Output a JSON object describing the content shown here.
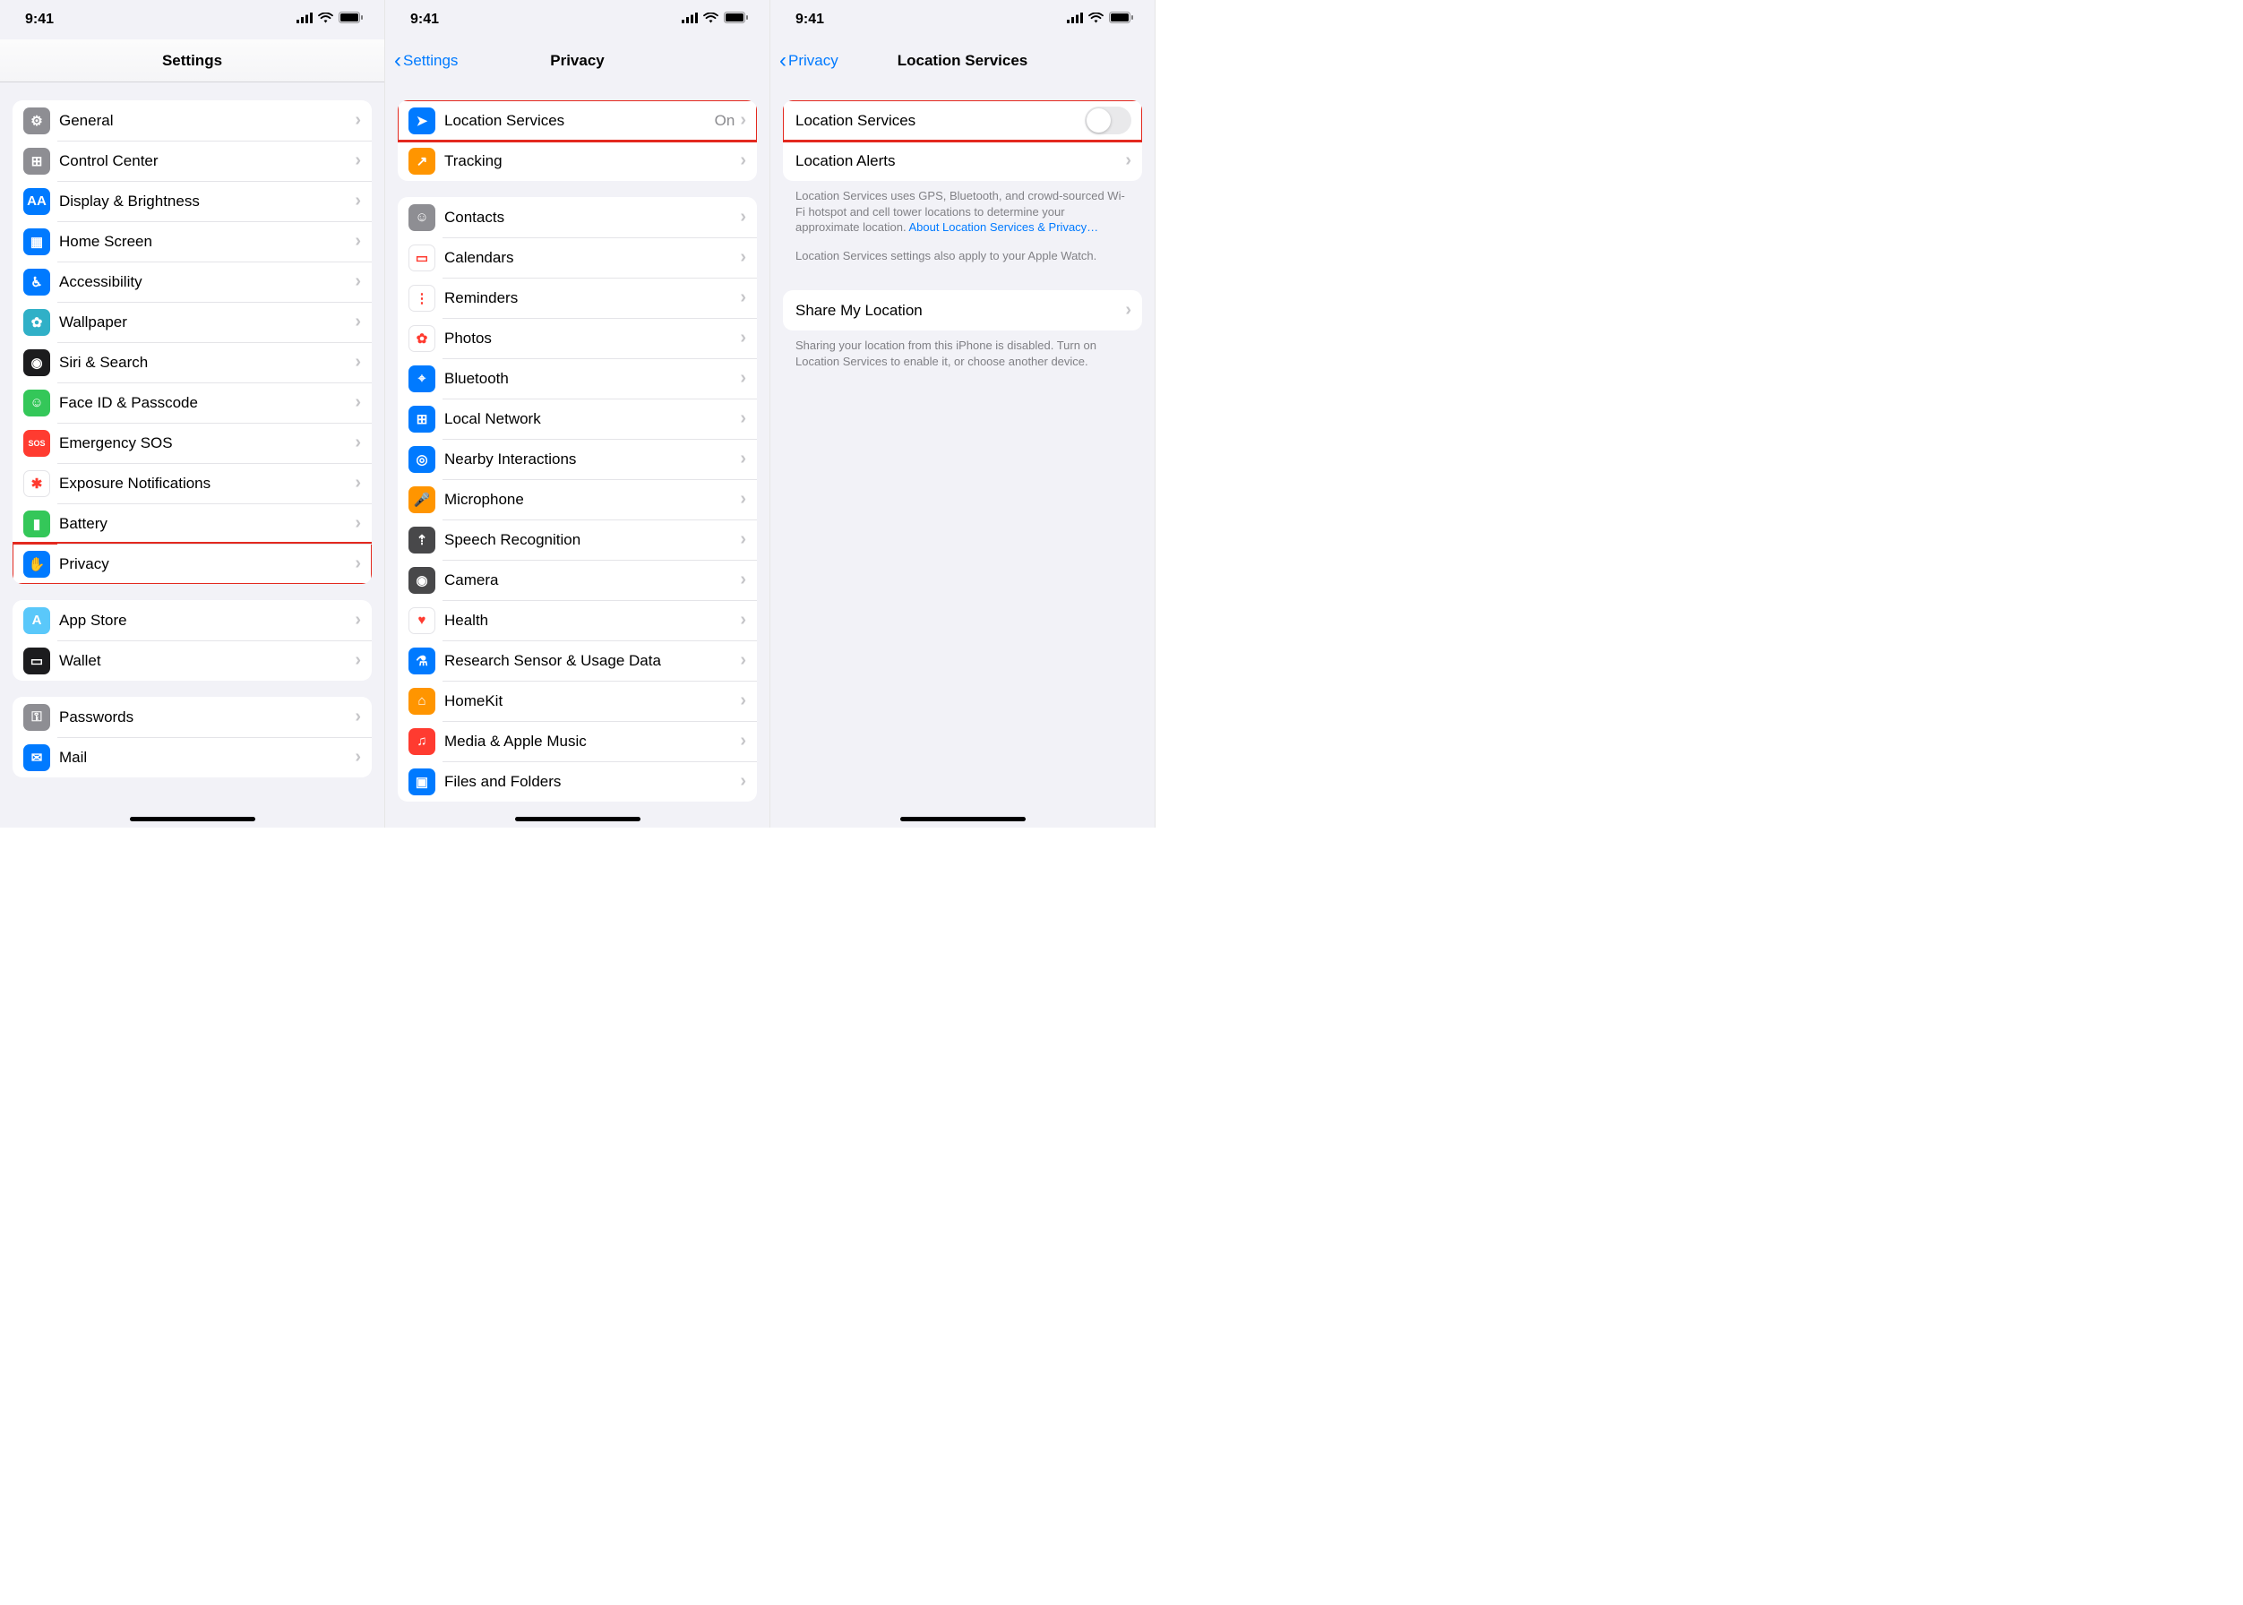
{
  "status": {
    "time": "9:41"
  },
  "screen1": {
    "title": "Settings",
    "group1": [
      {
        "icon": "gear-icon",
        "bg": "bg-grey",
        "glyph": "⚙︎",
        "label": "General"
      },
      {
        "icon": "control-center-icon",
        "bg": "bg-grey",
        "glyph": "⊞",
        "label": "Control Center"
      },
      {
        "icon": "display-icon",
        "bg": "bg-blue",
        "glyph": "AA",
        "label": "Display & Brightness"
      },
      {
        "icon": "home-screen-icon",
        "bg": "bg-blue",
        "glyph": "▦",
        "label": "Home Screen"
      },
      {
        "icon": "accessibility-icon",
        "bg": "bg-blue",
        "glyph": "♿︎",
        "label": "Accessibility"
      },
      {
        "icon": "wallpaper-icon",
        "bg": "bg-teal",
        "glyph": "✿",
        "label": "Wallpaper"
      },
      {
        "icon": "siri-icon",
        "bg": "bg-black",
        "glyph": "◉",
        "label": "Siri & Search"
      },
      {
        "icon": "faceid-icon",
        "bg": "bg-green",
        "glyph": "☺︎",
        "label": "Face ID & Passcode"
      },
      {
        "icon": "sos-icon",
        "bg": "bg-red",
        "glyph": "SOS",
        "label": "Emergency SOS"
      },
      {
        "icon": "exposure-icon",
        "bg": "bg-white",
        "glyph": "✱",
        "label": "Exposure Notifications"
      },
      {
        "icon": "battery-icon",
        "bg": "bg-green",
        "glyph": "▮",
        "label": "Battery"
      },
      {
        "icon": "privacy-icon",
        "bg": "bg-blue",
        "glyph": "✋",
        "label": "Privacy",
        "highlight": true
      }
    ],
    "group2": [
      {
        "icon": "appstore-icon",
        "bg": "bg-cyan",
        "glyph": "A",
        "label": "App Store"
      },
      {
        "icon": "wallet-icon",
        "bg": "bg-black",
        "glyph": "▭",
        "label": "Wallet"
      }
    ],
    "group3": [
      {
        "icon": "passwords-icon",
        "bg": "bg-grey",
        "glyph": "⚿",
        "label": "Passwords"
      },
      {
        "icon": "mail-icon",
        "bg": "bg-blue",
        "glyph": "✉︎",
        "label": "Mail"
      }
    ]
  },
  "screen2": {
    "back": "Settings",
    "title": "Privacy",
    "group1": [
      {
        "icon": "location-icon",
        "bg": "bg-blue",
        "glyph": "➤",
        "label": "Location Services",
        "detail": "On",
        "highlight": true
      },
      {
        "icon": "tracking-icon",
        "bg": "bg-orange",
        "glyph": "↗︎",
        "label": "Tracking"
      }
    ],
    "group2": [
      {
        "icon": "contacts-icon",
        "bg": "bg-grey",
        "glyph": "☺",
        "label": "Contacts"
      },
      {
        "icon": "calendar-icon",
        "bg": "bg-white",
        "glyph": "▭",
        "label": "Calendars"
      },
      {
        "icon": "reminders-icon",
        "bg": "bg-white",
        "glyph": "⋮",
        "label": "Reminders"
      },
      {
        "icon": "photos-icon",
        "bg": "bg-white",
        "glyph": "✿",
        "label": "Photos"
      },
      {
        "icon": "bluetooth-icon",
        "bg": "bg-blue",
        "glyph": "⌖",
        "label": "Bluetooth"
      },
      {
        "icon": "network-icon",
        "bg": "bg-blue",
        "glyph": "⊞",
        "label": "Local Network"
      },
      {
        "icon": "nearby-icon",
        "bg": "bg-blue",
        "glyph": "◎",
        "label": "Nearby Interactions"
      },
      {
        "icon": "microphone-icon",
        "bg": "bg-orange",
        "glyph": "🎤",
        "label": "Microphone"
      },
      {
        "icon": "speech-icon",
        "bg": "bg-dgrey",
        "glyph": "⇡",
        "label": "Speech Recognition"
      },
      {
        "icon": "camera-icon",
        "bg": "bg-dgrey",
        "glyph": "◉",
        "label": "Camera"
      },
      {
        "icon": "health-icon",
        "bg": "bg-white",
        "glyph": "♥",
        "label": "Health"
      },
      {
        "icon": "research-icon",
        "bg": "bg-blue",
        "glyph": "⚗",
        "label": "Research Sensor & Usage Data"
      },
      {
        "icon": "homekit-icon",
        "bg": "bg-orange",
        "glyph": "⌂",
        "label": "HomeKit"
      },
      {
        "icon": "media-icon",
        "bg": "bg-red",
        "glyph": "♫",
        "label": "Media & Apple Music"
      },
      {
        "icon": "files-icon",
        "bg": "bg-blue",
        "glyph": "▣",
        "label": "Files and Folders"
      }
    ]
  },
  "screen3": {
    "back": "Privacy",
    "title": "Location Services",
    "group1": [
      {
        "label": "Location Services",
        "type": "switch",
        "highlight": true
      },
      {
        "label": "Location Alerts",
        "type": "chevron"
      }
    ],
    "footer1_a": "Location Services uses GPS, Bluetooth, and crowd-sourced Wi-Fi hotspot and cell tower locations to determine your approximate location. ",
    "footer1_link": "About Location Services & Privacy…",
    "footer1_b": "Location Services settings also apply to your Apple Watch.",
    "group2": [
      {
        "label": "Share My Location",
        "type": "chevron"
      }
    ],
    "footer2": "Sharing your location from this iPhone is disabled. Turn on Location Services to enable it, or choose another device."
  }
}
